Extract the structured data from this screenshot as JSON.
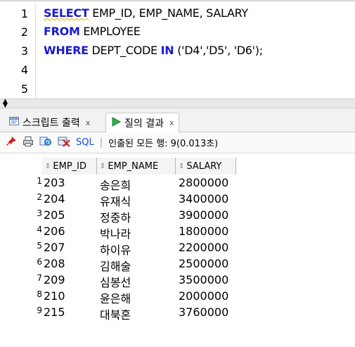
{
  "editor": {
    "lines": [
      {
        "num": "1",
        "kw1": "SELECT",
        "rest1": " EMP_ID, EMP_NAME, SALARY",
        "kw2": "",
        "rest2": ""
      },
      {
        "num": "2",
        "kw1": "FROM",
        "rest1": " EMPLOYEE",
        "kw2": "",
        "rest2": ""
      },
      {
        "num": "3",
        "kw1": "WHERE",
        "rest1": " DEPT_CODE ",
        "kw2": "IN",
        "rest2": " ('D4','D5', 'D6');"
      },
      {
        "num": "4",
        "kw1": "",
        "rest1": "",
        "kw2": "",
        "rest2": ""
      },
      {
        "num": "5",
        "kw1": "",
        "rest1": "",
        "kw2": "",
        "rest2": ""
      }
    ],
    "keyword_color": "#1a1ad0"
  },
  "tabs": [
    {
      "label": "스크립트 출력",
      "close": "x",
      "icon": "script-output-icon"
    },
    {
      "label": "질의 결과",
      "close": "x",
      "icon": "run-query-icon"
    }
  ],
  "toolbar": {
    "sql_label": "SQL",
    "separator": "|",
    "info": "인출된 모든 행: 9(0.013초)"
  },
  "grid": {
    "columns": [
      "EMP_ID",
      "EMP_NAME",
      "SALARY"
    ],
    "rows": [
      {
        "n": "1",
        "id": "203",
        "name": "송은희",
        "salary": "2800000"
      },
      {
        "n": "2",
        "id": "204",
        "name": "유재식",
        "salary": "3400000"
      },
      {
        "n": "3",
        "id": "205",
        "name": "정중하",
        "salary": "3900000"
      },
      {
        "n": "4",
        "id": "206",
        "name": "박나라",
        "salary": "1800000"
      },
      {
        "n": "5",
        "id": "207",
        "name": "하이유",
        "salary": "2200000"
      },
      {
        "n": "6",
        "id": "208",
        "name": "김해술",
        "salary": "2500000"
      },
      {
        "n": "7",
        "id": "209",
        "name": "심봉선",
        "salary": "3500000"
      },
      {
        "n": "8",
        "id": "210",
        "name": "윤은해",
        "salary": "2000000"
      },
      {
        "n": "9",
        "id": "215",
        "name": "대북혼",
        "salary": "3760000"
      }
    ]
  }
}
